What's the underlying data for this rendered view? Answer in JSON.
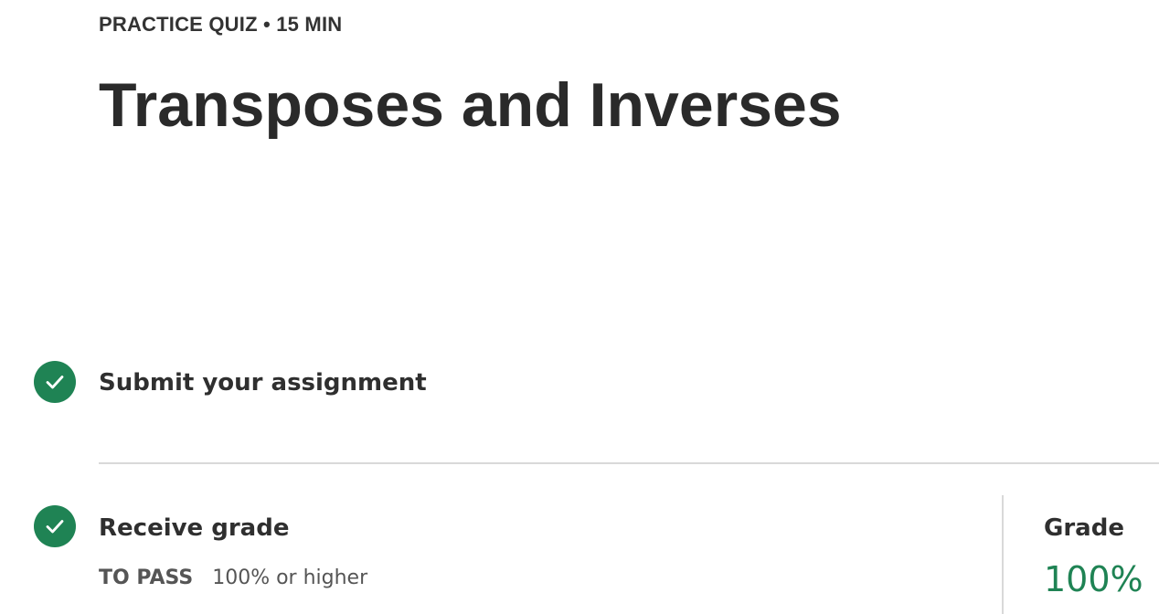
{
  "header": {
    "eyebrow": "PRACTICE QUIZ • 15 MIN",
    "title": "Transposes and Inverses"
  },
  "steps": [
    {
      "label": "Submit your assignment",
      "status_icon": "check-circle-icon",
      "completed": true
    },
    {
      "label": "Receive grade",
      "status_icon": "check-circle-icon",
      "completed": true,
      "pass_label": "TO PASS",
      "pass_value": "100% or higher"
    }
  ],
  "grade": {
    "label": "Grade",
    "value": "100%"
  },
  "colors": {
    "success": "#1f8354",
    "text": "#333333",
    "divider": "#d9d9d9"
  }
}
